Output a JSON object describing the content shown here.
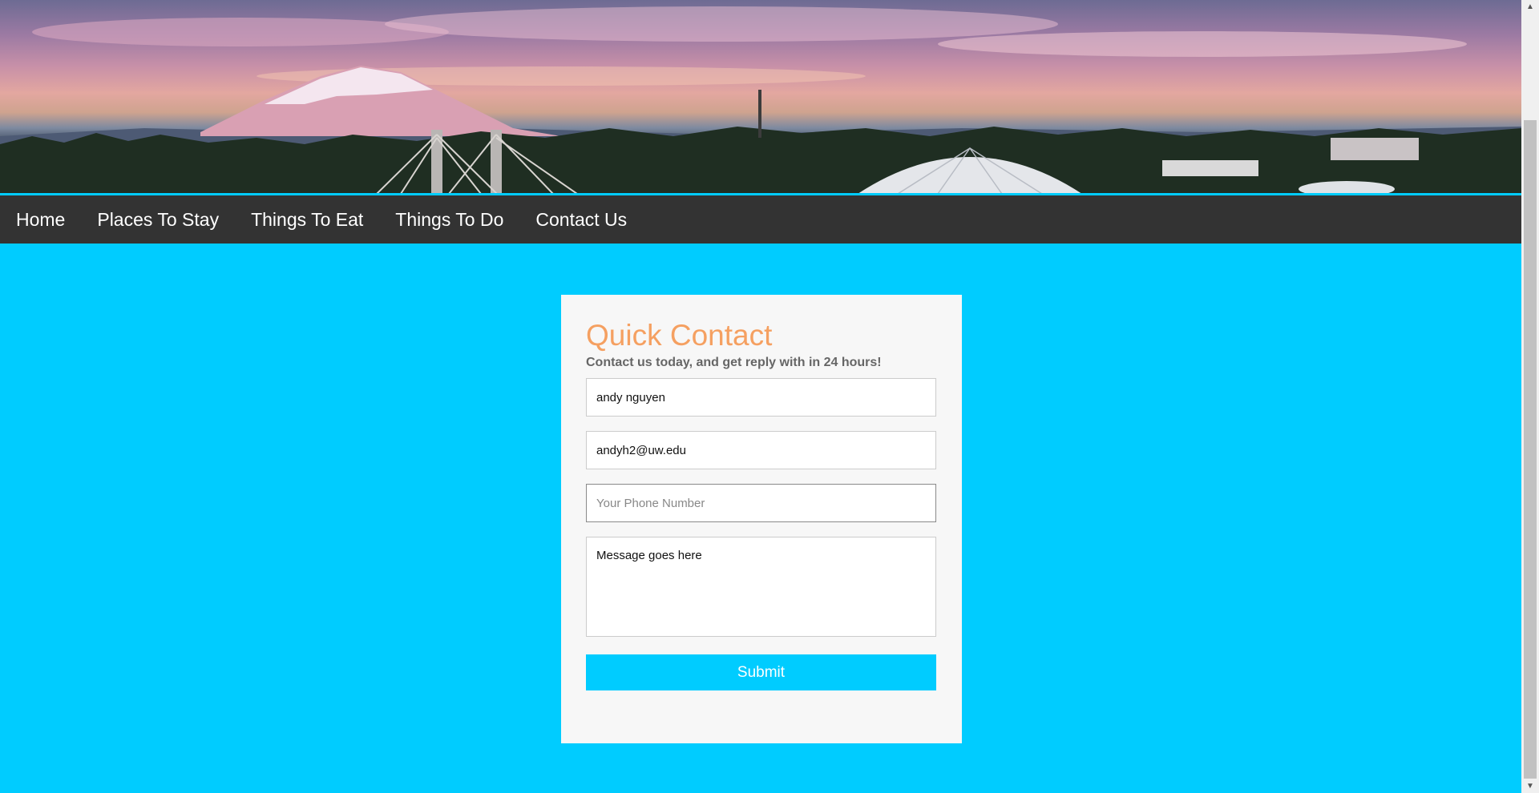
{
  "nav": {
    "items": [
      "Home",
      "Places To Stay",
      "Things To Eat",
      "Things To Do",
      "Contact Us"
    ]
  },
  "contact": {
    "title": "Quick Contact",
    "subtitle": "Contact us today, and get reply with in 24 hours!",
    "name_value": "andy nguyen",
    "email_value": "andyh2@uw.edu",
    "phone_placeholder": "Your Phone Number",
    "phone_value": "",
    "message_value": "Message goes here",
    "submit_label": "Submit"
  },
  "colors": {
    "page_bg": "#00ccff",
    "nav_bg": "#333333",
    "title": "#f5a061",
    "card_bg": "#f7f7f7"
  },
  "icons": {
    "scroll_up": "scroll-up-arrow-icon",
    "scroll_down": "scroll-down-arrow-icon"
  }
}
